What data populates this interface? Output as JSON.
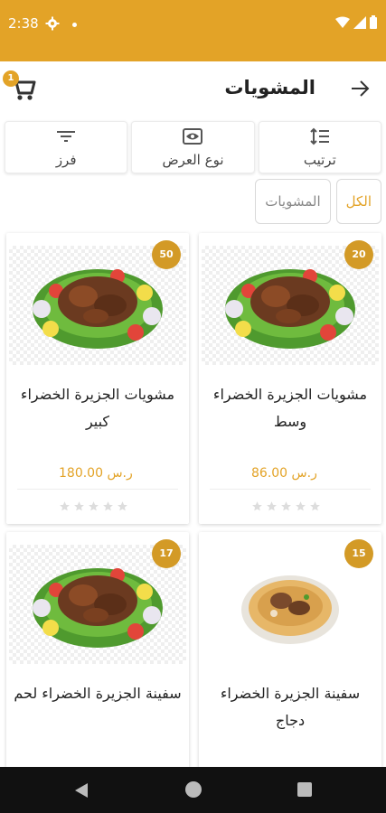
{
  "status_bar": {
    "time": "2:38"
  },
  "app_bar": {
    "title": "المشويات",
    "cart_count": "1"
  },
  "toolbar": [
    {
      "label": "ترتيب",
      "icon": "sort-icon"
    },
    {
      "label": "نوع العرض",
      "icon": "eye-icon"
    },
    {
      "label": "فرز",
      "icon": "filter-icon"
    }
  ],
  "chips": [
    {
      "label": "الكل",
      "selected": true
    },
    {
      "label": "المشويات",
      "selected": false
    }
  ],
  "products": [
    {
      "name": "مشويات الجزيرة الخضراء وسط",
      "price": "86.00 ر.س",
      "count": "20",
      "image": "grill-platter",
      "rating": 0
    },
    {
      "name": "مشويات الجزيرة الخضراء كبير",
      "price": "180.00 ر.س",
      "count": "50",
      "image": "grill-platter",
      "rating": 0
    },
    {
      "name": "سفينة الجزيرة الخضراء دجاج",
      "price": "",
      "count": "15",
      "image": "rice-platter",
      "rating": 0
    },
    {
      "name": "سفينة الجزيرة الخضراء لحم",
      "price": "",
      "count": "17",
      "image": "grill-platter",
      "rating": 0
    }
  ],
  "colors": {
    "accent": "#e3a327",
    "badge": "#d39a26",
    "status_bar": "#e3a327"
  }
}
